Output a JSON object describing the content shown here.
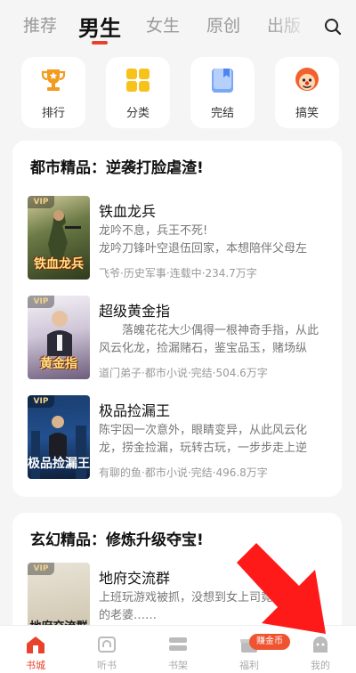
{
  "top_tabs": [
    {
      "label": "推荐"
    },
    {
      "label": "男生"
    },
    {
      "label": "女生"
    },
    {
      "label": "原创"
    },
    {
      "label": "出版"
    }
  ],
  "categories": [
    {
      "label": "排行",
      "icon": "trophy-icon"
    },
    {
      "label": "分类",
      "icon": "grid-icon"
    },
    {
      "label": "完结",
      "icon": "book-icon"
    },
    {
      "label": "搞笑",
      "icon": "clown-icon"
    }
  ],
  "sections": [
    {
      "title": "都市精品：逆袭打脸虐渣!",
      "books": [
        {
          "title": "铁血龙兵",
          "cover_text": "铁血龙兵",
          "desc": "龙吟不息，兵王不死!\n龙吟刀锋叶空退伍回家，本想陪伴父母左右…",
          "meta": "飞爷·历史军事·连载中·234.7万字"
        },
        {
          "title": "超级黄金指",
          "cover_text": "黄金指",
          "desc": "落魄花花大少偶得一根神奇手指，从此风云化龙，捡漏赌石，鉴宝品玉，赌场纵横，…",
          "meta": "道门弟子·都市小说·完结·504.6万字"
        },
        {
          "title": "极品捡漏王",
          "cover_text": "极品捡漏王",
          "desc": "陈宇因一次意外，眼睛变异，从此风云化龙，捞金捡漏，玩转古玩，一步步走上逆袭…",
          "meta": "有聊的鱼·都市小说·完结·496.8万字"
        }
      ]
    },
    {
      "title": "玄幻精品：修炼升级夺宝!",
      "books": [
        {
          "title": "地府交流群",
          "cover_text": "地府交流群",
          "desc": "上班玩游戏被抓，没想到女上司竟然是地府的老婆……",
          "meta": ""
        }
      ]
    }
  ],
  "bottom_nav": [
    {
      "label": "书城",
      "icon": "home-icon"
    },
    {
      "label": "听书",
      "icon": "headphones-icon"
    },
    {
      "label": "书架",
      "icon": "bookshelf-icon"
    },
    {
      "label": "福利",
      "icon": "gift-icon"
    },
    {
      "label": "我的",
      "icon": "profile-icon"
    }
  ],
  "coin_badge": "赚金币",
  "vip_label": "VIP",
  "colors": {
    "accent": "#e8412c",
    "arrow": "#ff1a1a",
    "badge": "#f0532f"
  }
}
